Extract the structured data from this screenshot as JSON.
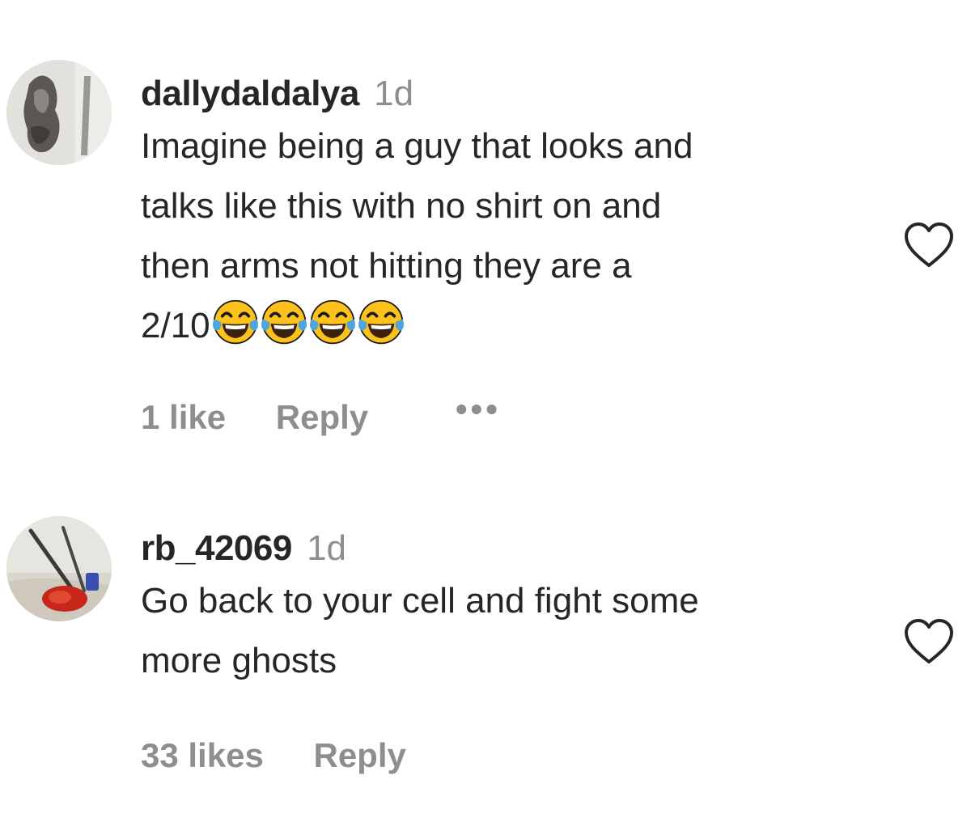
{
  "comments": [
    {
      "username": "dallydaldalya",
      "timestamp": "1d",
      "text_lines": [
        "Imagine being a guy that looks and",
        "talks like this with no shirt on and",
        "then arms not hitting they are a",
        "2/10"
      ],
      "emojis": [
        "tears-of-joy-emoji",
        "tears-of-joy-emoji",
        "tears-of-joy-emoji",
        "tears-of-joy-emoji"
      ],
      "likes_label": "1 like",
      "reply_label": "Reply",
      "more_label": "•••",
      "like_icon": "heart-outline-icon"
    },
    {
      "username": "rb_42069",
      "timestamp": "1d",
      "text_lines": [
        "Go back to your cell and fight some",
        "more ghosts"
      ],
      "likes_label": "33 likes",
      "reply_label": "Reply",
      "like_icon": "heart-outline-icon"
    }
  ],
  "colors": {
    "text": "#262626",
    "secondary": "#8e8e8e",
    "emoji_face": "#fcc21b",
    "emoji_tear": "#4fa5dd"
  }
}
